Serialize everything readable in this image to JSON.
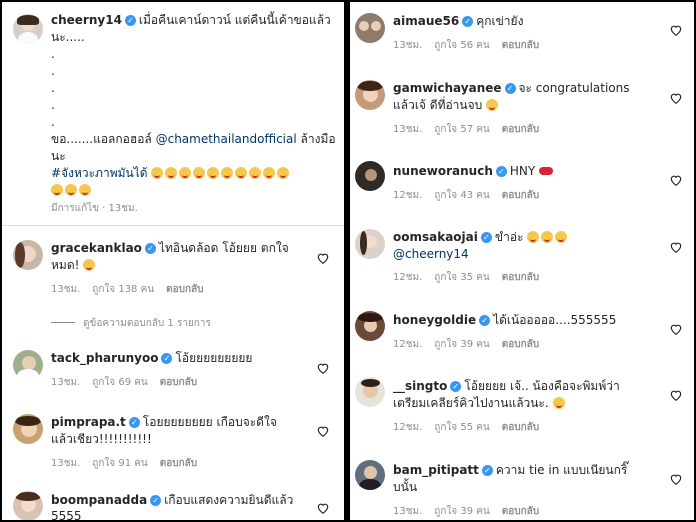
{
  "left": {
    "post": {
      "username": "cheerny14",
      "caption_1": "เมื่อคืนเคาน์ดาวน์ แต่คืนนี้เค้าขอแล้ว",
      "caption_2": "นะ.....",
      "dots": [
        ".",
        ".",
        ".",
        ".",
        "."
      ],
      "line_kor": "ขอ.......แอลกอฮอล์",
      "mention": "@chamethailandofficial",
      "line_after_mention": "ล้างมือ",
      "line_na": "นะ",
      "hashtag": "#จังหวะภาพมันได้",
      "edited": "มีการแก้ไข · 13ชม."
    },
    "comments": [
      {
        "user": "gracekanklao",
        "text1": "ไทอินดล้อด โอ้ยยย ตกใจ",
        "text2": "หมด!",
        "time": "13ชม.",
        "likes": "ถูกใจ 138 คน",
        "reply": "ตอบกลับ"
      },
      {
        "user": "tack_pharunyoo",
        "text1": "โอ้ยยยยยยยยย",
        "time": "13ชม.",
        "likes": "ถูกใจ 69 คน",
        "reply": "ตอบกลับ"
      },
      {
        "user": "pimprapa.t",
        "text1": "โอยยยยยยยย เกือบจะดีใจ",
        "text2": "แล้วเชียว!!!!!!!!!!!",
        "time": "13ชม.",
        "likes": "ถูกใจ 91 คน",
        "reply": "ตอบกลับ"
      },
      {
        "user": "boompanadda",
        "text1": "เกือบแสดงความยินดีแล้ว",
        "text2": "5555"
      }
    ],
    "view_replies": "ดูข้อความตอบกลับ 1 รายการ"
  },
  "right": {
    "comments": [
      {
        "user": "aimaue56",
        "text1": "คุกเข่ายัง",
        "time": "13ชม.",
        "likes": "ถูกใจ 56 คน",
        "reply": "ตอบกลับ"
      },
      {
        "user": "gamwichayanee",
        "text1": "จะ congratulations",
        "text2": "แล้วเจ้ ดีที่อ่านจบ",
        "time": "13ชม.",
        "likes": "ถูกใจ 57 คน",
        "reply": "ตอบกลับ"
      },
      {
        "user": "nuneworanuch",
        "text1": "HNY",
        "time": "12ชม.",
        "likes": "ถูกใจ 43 คน",
        "reply": "ตอบกลับ"
      },
      {
        "user": "oomsakaojai",
        "text1": "ขำอ่ะ",
        "text2": "@cheerny14",
        "time": "12ชม.",
        "likes": "ถูกใจ 35 คน",
        "reply": "ตอบกลับ"
      },
      {
        "user": "honeygoldie",
        "text1": "ได้เน้อออออ....555555",
        "time": "12ชม.",
        "likes": "ถูกใจ 39 คน",
        "reply": "ตอบกลับ"
      },
      {
        "user": "__singto",
        "text1": "โอ้ยยยย เจ้.. น้องคือจะพิมพ์ว่า",
        "text2": "เตรียมเคลียร์คิวไปงานแล้วนะ.",
        "time": "12ชม.",
        "likes": "ถูกใจ 55 คน",
        "reply": "ตอบกลับ"
      },
      {
        "user": "bam_pitipatt",
        "text1": "ความ tie in แบบเนียนกริ๊",
        "text2": "บนั้น",
        "time": "13ชม.",
        "likes": "ถูกใจ 39 คน",
        "reply": "ตอบกลับ"
      }
    ]
  },
  "colors": {
    "text": "#262626",
    "meta": "#8e8e8e",
    "verified": "#3897f0",
    "mention": "#003569",
    "divider": "#dbdbdb"
  }
}
